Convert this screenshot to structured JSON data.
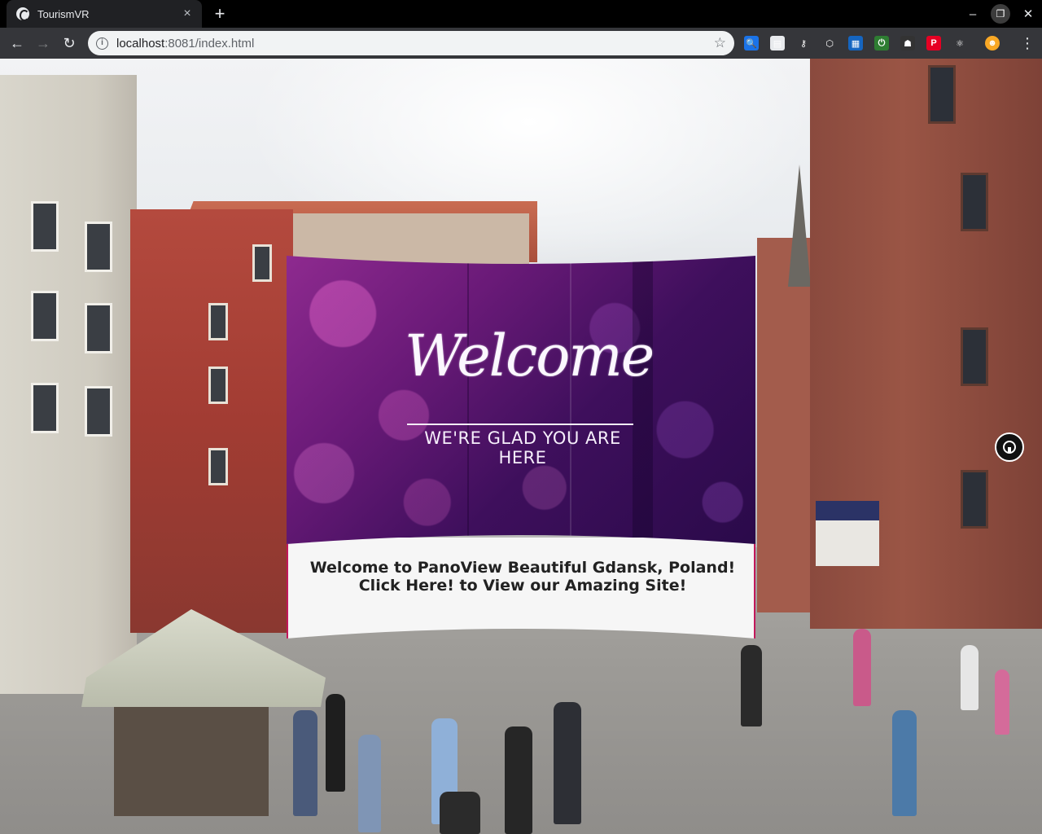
{
  "browser": {
    "tab_title": "TourismVR",
    "tab_close": "×",
    "new_tab": "+",
    "url_host": "localhost",
    "url_rest": ":8081/index.html",
    "window_minimize": "–",
    "window_restore": "❐",
    "window_close": "✕",
    "extensions": [
      {
        "icon": "search-extension-icon",
        "color": "#1a73e8",
        "glyph": "🔍"
      },
      {
        "icon": "sheet-extension-icon",
        "color": "#e8eaed",
        "glyph": "▤"
      },
      {
        "icon": "key-extension-icon",
        "color": "#35363a",
        "glyph": "⚷"
      },
      {
        "icon": "cube-extension-icon",
        "color": "#35363a",
        "glyph": "⬡"
      },
      {
        "icon": "window-extension-icon",
        "color": "#1565c0",
        "glyph": "▦"
      },
      {
        "icon": "power-extension-icon",
        "color": "#2e7d32",
        "glyph": "⏻"
      },
      {
        "icon": "bug-extension-icon",
        "color": "#333333",
        "glyph": "☗"
      },
      {
        "icon": "pinterest-extension-icon",
        "color": "#e60023",
        "glyph": "P"
      },
      {
        "icon": "atom-extension-icon",
        "color": "#35363a",
        "glyph": "⚛"
      },
      {
        "icon": "profile-avatar-icon",
        "color": "#f9a825",
        "glyph": "☻"
      }
    ]
  },
  "panel": {
    "headline": "Welcome",
    "subline": "WE'RE GLAD YOU ARE HERE",
    "caption": "Welcome to PanoView Beautiful Gdansk, Poland! Click Here! to View our Amazing Site!"
  },
  "colors": {
    "panel_accent": "#c2185b",
    "panel_purple": "#6a1a78"
  }
}
